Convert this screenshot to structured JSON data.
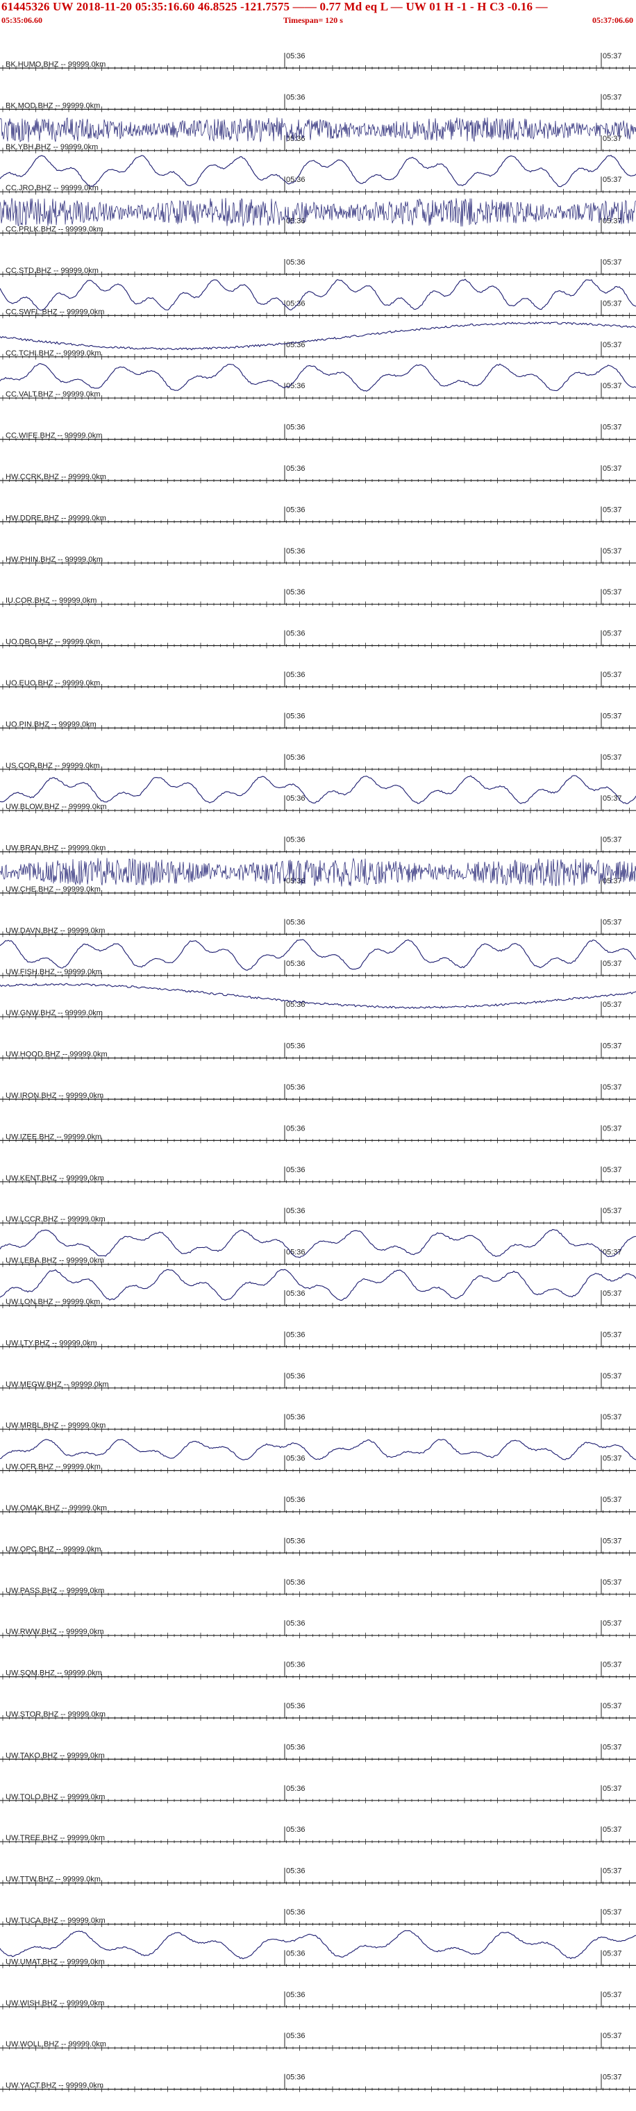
{
  "header": {
    "title": "61445326 UW 2018-11-20 05:35:16.60   46.8525 -121.7575 ——  0.77 Md  eq  L —    UW 01  H  -1  -  H C3   -0.16 —",
    "start_time": "05:35:06.60",
    "timespan": "Timespan= 120 s",
    "end_time": "05:37:06.60"
  },
  "colors": {
    "header_text": "#cc0000",
    "trace": "#1a1a6e",
    "axis": "#222222",
    "pick": "#cc0000"
  },
  "chart_data": {
    "type": "line",
    "x_tick_labels": [
      "05:36",
      "05:37"
    ],
    "channels": [
      {
        "label": "BK.HUMO.BHZ -- 99999.0km",
        "amp": 0,
        "style": "flat"
      },
      {
        "label": "BK.MOD.BHZ -- 99999.0km",
        "amp": 0,
        "style": "flat"
      },
      {
        "label": "BK.YBH.BHZ -- 99999.0km",
        "amp": 0.7,
        "style": "noise"
      },
      {
        "label": "CC.JRO.BHZ -- 99999.0km",
        "amp": 0.9,
        "style": "wave"
      },
      {
        "label": "CC.PRLK.BHZ -- 99999.0km",
        "amp": 0.8,
        "style": "noise"
      },
      {
        "label": "CC.STD.BHZ -- 99999.0km",
        "amp": 0,
        "style": "flat"
      },
      {
        "label": "CC.SWFL.BHZ -- 99999.0km",
        "amp": 0.9,
        "style": "wave"
      },
      {
        "label": "CC.TCHI.BHZ -- 99999.0km",
        "amp": 0.9,
        "style": "drift"
      },
      {
        "label": "CC.VALT.BHZ -- 99999.0km",
        "amp": 0.8,
        "style": "wave"
      },
      {
        "label": "CC.WIFE.BHZ -- 99999.0km",
        "amp": 0,
        "style": "flat"
      },
      {
        "label": "HW.CCRK.BHZ -- 99999.0km",
        "amp": 0,
        "style": "flat"
      },
      {
        "label": "HW.DDRE.BHZ -- 99999.0km",
        "amp": 0,
        "style": "flat"
      },
      {
        "label": "HW.PHIN.BHZ -- 99999.0km",
        "amp": 0,
        "style": "flat"
      },
      {
        "label": "IU.COR.BHZ -- 99999.0km",
        "amp": 0,
        "style": "flat"
      },
      {
        "label": "UO.DBO.BHZ -- 99999.0km",
        "amp": 0,
        "style": "flat"
      },
      {
        "label": "UO.EUO.BHZ -- 99999.0km",
        "amp": 0,
        "style": "flat"
      },
      {
        "label": "UO.PIN.BHZ -- 99999.0km",
        "amp": 0,
        "style": "flat"
      },
      {
        "label": "US.COR.BHZ -- 99999.0km",
        "amp": 0,
        "style": "flat"
      },
      {
        "label": "UW.BLOW.BHZ -- 99999.0km",
        "amp": 0.8,
        "style": "wave"
      },
      {
        "label": "UW.BRAN.BHZ -- 99999.0km",
        "amp": 0,
        "style": "flat"
      },
      {
        "label": "UW.CHE.BHZ -- 99999.0km",
        "amp": 0.8,
        "style": "noise"
      },
      {
        "label": "UW.DAVN.BHZ -- 99999.0km",
        "amp": 0,
        "style": "flat"
      },
      {
        "label": "UW.FISH.BHZ -- 99999.0km",
        "amp": 0.9,
        "style": "wave"
      },
      {
        "label": "UW.GNW.BHZ -- 99999.0km",
        "amp": 0.8,
        "style": "drift"
      },
      {
        "label": "UW.HOOD.BHZ -- 99999.0km",
        "amp": 0,
        "style": "flat"
      },
      {
        "label": "UW.IRON.BHZ -- 99999.0km",
        "amp": 0,
        "style": "flat"
      },
      {
        "label": "UW.IZEE.BHZ -- 99999.0km",
        "amp": 0,
        "style": "flat"
      },
      {
        "label": "UW.KENT.BHZ -- 99999.0km",
        "amp": 0,
        "style": "flat"
      },
      {
        "label": "UW.LCCR.BHZ -- 99999.0km",
        "amp": 0,
        "style": "flat"
      },
      {
        "label": "UW.LEBA.BHZ -- 99999.0km",
        "amp": 0.8,
        "style": "wave"
      },
      {
        "label": "UW.LON.BHZ -- 99999.0km",
        "amp": 0.9,
        "style": "wave"
      },
      {
        "label": "UW.LTY.BHZ -- 99999.0km",
        "amp": 0,
        "style": "flat"
      },
      {
        "label": "UW.MEGW.BHZ -- 99999.0km",
        "amp": 0,
        "style": "flat"
      },
      {
        "label": "UW.MRBL.BHZ -- 99999.0km",
        "amp": 0,
        "style": "flat"
      },
      {
        "label": "UW.OFR.BHZ -- 99999.0km",
        "amp": 0.6,
        "style": "wave"
      },
      {
        "label": "UW.OMAK.BHZ -- 99999.0km",
        "amp": 0,
        "style": "flat"
      },
      {
        "label": "UW.OPC.BHZ -- 99999.0km",
        "amp": 0,
        "style": "flat"
      },
      {
        "label": "UW.PASS.BHZ -- 99999.0km",
        "amp": 0,
        "style": "flat"
      },
      {
        "label": "UW.RWW.BHZ -- 99999.0km",
        "amp": 0,
        "style": "flat"
      },
      {
        "label": "UW.SQM.BHZ -- 99999.0km",
        "amp": 0,
        "style": "flat"
      },
      {
        "label": "UW.STOR.BHZ -- 99999.0km",
        "amp": 0,
        "style": "flat"
      },
      {
        "label": "UW.TAKO.BHZ -- 99999.0km",
        "amp": 0,
        "style": "flat"
      },
      {
        "label": "UW.TOLO.BHZ -- 99999.0km",
        "amp": 0,
        "style": "flat"
      },
      {
        "label": "UW.TREE.BHZ -- 99999.0km",
        "amp": 0,
        "style": "flat"
      },
      {
        "label": "UW.TTW.BHZ -- 99999.0km",
        "amp": 0,
        "style": "flat"
      },
      {
        "label": "UW.TUCA.BHZ -- 99999.0km",
        "amp": 0,
        "style": "flat"
      },
      {
        "label": "UW.UMAT.BHZ -- 99999.0km",
        "amp": 0.8,
        "style": "wave"
      },
      {
        "label": "UW.WISH.BHZ -- 99999.0km",
        "amp": 0,
        "style": "flat"
      },
      {
        "label": "UW.WOLL.BHZ -- 99999.0km",
        "amp": 0,
        "style": "flat"
      },
      {
        "label": "UW.YACT.BHZ -- 99999.0km",
        "amp": 0,
        "style": "flat"
      }
    ]
  }
}
